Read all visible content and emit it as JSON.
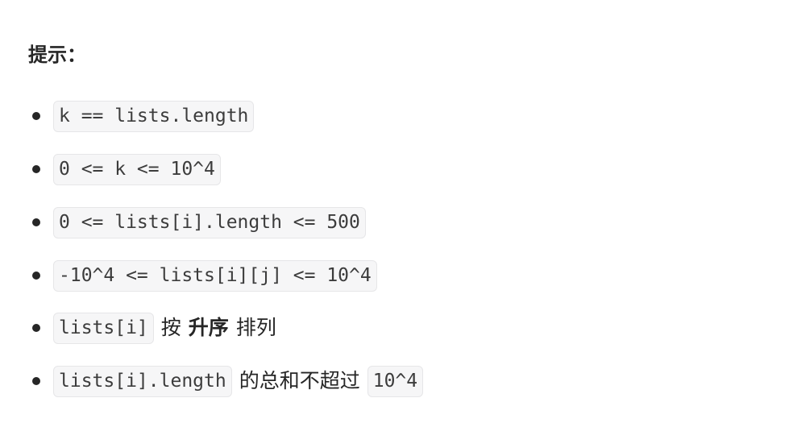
{
  "heading": "提示：",
  "items": [
    {
      "code": "k == lists.length"
    },
    {
      "code": "0 <= k <= 10^4"
    },
    {
      "code": "0 <= lists[i].length <= 500"
    },
    {
      "code": "-10^4 <= lists[i][j] <= 10^4"
    },
    {
      "code": "lists[i]",
      "text_before_bold": "按",
      "bold": "升序",
      "text_after_bold": "排列"
    },
    {
      "code": "lists[i].length",
      "text": "的总和不超过",
      "code2": "10^4"
    }
  ]
}
